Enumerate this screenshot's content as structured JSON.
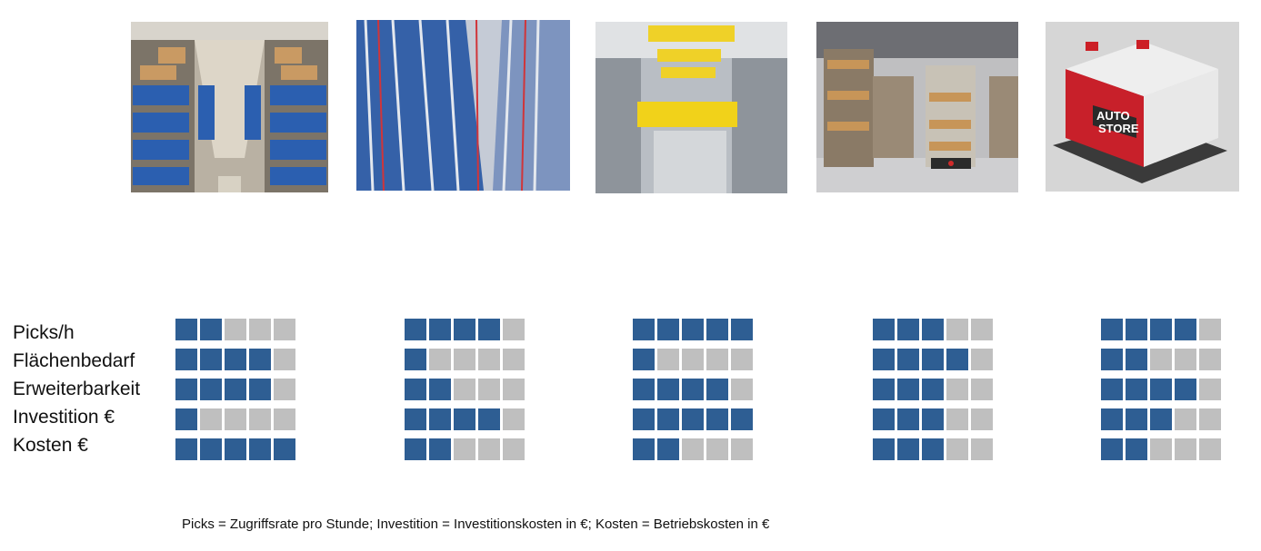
{
  "colors": {
    "filled": "#2e5e93",
    "empty": "#bfbfbf"
  },
  "criteria": [
    "Picks/h",
    "Flächenbedarf",
    "Erweiterbarkeit",
    "Investition €",
    "Kosten €"
  ],
  "scale_max": 5,
  "systems": [
    {
      "image": "manual-shelving-aisle-photo",
      "ratings": [
        2,
        4,
        4,
        1,
        5
      ]
    },
    {
      "image": "high-bay-miniload-rack-photo",
      "ratings": [
        4,
        1,
        2,
        4,
        2
      ]
    },
    {
      "image": "shuttle-system-photo",
      "ratings": [
        5,
        1,
        4,
        5,
        2
      ]
    },
    {
      "image": "goods-to-person-robot-shelves-photo",
      "ratings": [
        3,
        4,
        3,
        3,
        3
      ]
    },
    {
      "image": "autostore-cube-storage-photo",
      "ratings": [
        4,
        2,
        4,
        3,
        2
      ]
    }
  ],
  "autostore_logo": [
    "AUTO",
    "STORE"
  ],
  "footnote": "Picks = Zugriffsrate pro Stunde; Investition = Investitionskosten in €; Kosten = Betriebskosten in €"
}
